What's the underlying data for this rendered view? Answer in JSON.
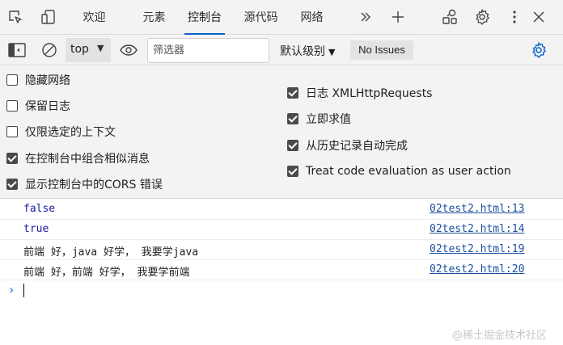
{
  "tabbar": {
    "tabs": [
      {
        "label": "欢迎"
      },
      {
        "label": "元素"
      },
      {
        "label": "控制台"
      },
      {
        "label": "源代码"
      },
      {
        "label": "网络"
      }
    ],
    "active_tab": "控制台",
    "accent": "#0a62c9"
  },
  "toolbar": {
    "context": "top",
    "filter_placeholder": "筛选器",
    "level_label": "默认级别",
    "issues_label": "No Issues"
  },
  "settings": {
    "left": [
      {
        "label": "隐藏网络",
        "checked": false
      },
      {
        "label": "保留日志",
        "checked": false
      },
      {
        "label": "仅限选定的上下文",
        "checked": false
      },
      {
        "label": "在控制台中组合相似消息",
        "checked": true
      },
      {
        "label": "显示控制台中的CORS 错误",
        "checked": true
      }
    ],
    "right": [
      {
        "label": "日志 XMLHttpRequests",
        "checked": true
      },
      {
        "label": "立即求值",
        "checked": true
      },
      {
        "label": "从历史记录自动完成",
        "checked": true
      },
      {
        "label": "Treat code evaluation as user action",
        "checked": true
      }
    ]
  },
  "console": {
    "messages": [
      {
        "value": "false",
        "source": "02test2.html:13"
      },
      {
        "value": "true",
        "source": "02test2.html:14"
      },
      {
        "value": "前端 好，java 好学， 我要学java",
        "source": "02test2.html:19"
      },
      {
        "value": "前端 好，前端 好学， 我要学前端",
        "source": "02test2.html:20"
      }
    ]
  },
  "watermark": "@稀土掘金技术社区"
}
